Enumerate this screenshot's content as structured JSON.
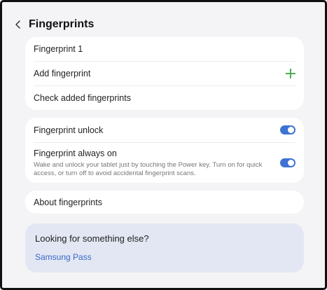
{
  "header": {
    "title": "Fingerprints",
    "back_icon": "chevron-left-icon"
  },
  "fingerprints_card": {
    "items": [
      {
        "label": "Fingerprint 1"
      },
      {
        "label": "Add fingerprint",
        "icon": "plus-icon"
      },
      {
        "label": "Check added fingerprints"
      }
    ]
  },
  "settings_card": {
    "unlock": {
      "label": "Fingerprint unlock",
      "enabled": true
    },
    "always_on": {
      "label": "Fingerprint always on",
      "description": "Wake and unlock your tablet just by touching the Power key. Turn on for quick access, or turn off to avoid accidental fingerprint scans.",
      "enabled": true
    }
  },
  "about": {
    "label": "About fingerprints"
  },
  "suggestion": {
    "title": "Looking for something else?",
    "link": "Samsung Pass"
  },
  "colors": {
    "toggle_on": "#3e73d6",
    "accent_plus": "#4caf50",
    "link": "#3a67c8",
    "suggestion_bg": "#e3e7f3"
  }
}
